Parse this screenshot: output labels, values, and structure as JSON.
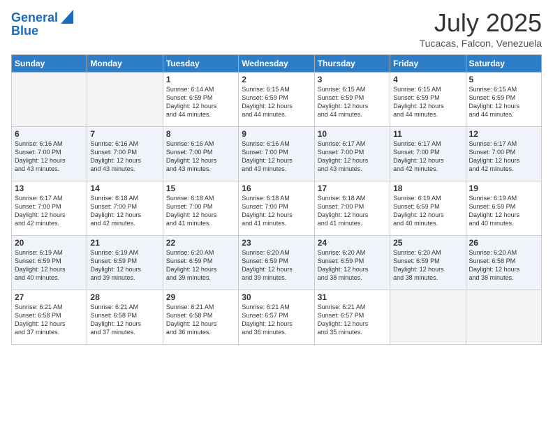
{
  "header": {
    "logo_line1": "General",
    "logo_line2": "Blue",
    "title": "July 2025",
    "location": "Tucacas, Falcon, Venezuela"
  },
  "days_of_week": [
    "Sunday",
    "Monday",
    "Tuesday",
    "Wednesday",
    "Thursday",
    "Friday",
    "Saturday"
  ],
  "weeks": [
    [
      {
        "day": "",
        "detail": "",
        "empty": true
      },
      {
        "day": "",
        "detail": "",
        "empty": true
      },
      {
        "day": "1",
        "detail": "Sunrise: 6:14 AM\nSunset: 6:59 PM\nDaylight: 12 hours\nand 44 minutes."
      },
      {
        "day": "2",
        "detail": "Sunrise: 6:15 AM\nSunset: 6:59 PM\nDaylight: 12 hours\nand 44 minutes."
      },
      {
        "day": "3",
        "detail": "Sunrise: 6:15 AM\nSunset: 6:59 PM\nDaylight: 12 hours\nand 44 minutes."
      },
      {
        "day": "4",
        "detail": "Sunrise: 6:15 AM\nSunset: 6:59 PM\nDaylight: 12 hours\nand 44 minutes."
      },
      {
        "day": "5",
        "detail": "Sunrise: 6:15 AM\nSunset: 6:59 PM\nDaylight: 12 hours\nand 44 minutes."
      }
    ],
    [
      {
        "day": "6",
        "detail": "Sunrise: 6:16 AM\nSunset: 7:00 PM\nDaylight: 12 hours\nand 43 minutes."
      },
      {
        "day": "7",
        "detail": "Sunrise: 6:16 AM\nSunset: 7:00 PM\nDaylight: 12 hours\nand 43 minutes."
      },
      {
        "day": "8",
        "detail": "Sunrise: 6:16 AM\nSunset: 7:00 PM\nDaylight: 12 hours\nand 43 minutes."
      },
      {
        "day": "9",
        "detail": "Sunrise: 6:16 AM\nSunset: 7:00 PM\nDaylight: 12 hours\nand 43 minutes."
      },
      {
        "day": "10",
        "detail": "Sunrise: 6:17 AM\nSunset: 7:00 PM\nDaylight: 12 hours\nand 43 minutes."
      },
      {
        "day": "11",
        "detail": "Sunrise: 6:17 AM\nSunset: 7:00 PM\nDaylight: 12 hours\nand 42 minutes."
      },
      {
        "day": "12",
        "detail": "Sunrise: 6:17 AM\nSunset: 7:00 PM\nDaylight: 12 hours\nand 42 minutes."
      }
    ],
    [
      {
        "day": "13",
        "detail": "Sunrise: 6:17 AM\nSunset: 7:00 PM\nDaylight: 12 hours\nand 42 minutes."
      },
      {
        "day": "14",
        "detail": "Sunrise: 6:18 AM\nSunset: 7:00 PM\nDaylight: 12 hours\nand 42 minutes."
      },
      {
        "day": "15",
        "detail": "Sunrise: 6:18 AM\nSunset: 7:00 PM\nDaylight: 12 hours\nand 41 minutes."
      },
      {
        "day": "16",
        "detail": "Sunrise: 6:18 AM\nSunset: 7:00 PM\nDaylight: 12 hours\nand 41 minutes."
      },
      {
        "day": "17",
        "detail": "Sunrise: 6:18 AM\nSunset: 7:00 PM\nDaylight: 12 hours\nand 41 minutes."
      },
      {
        "day": "18",
        "detail": "Sunrise: 6:19 AM\nSunset: 6:59 PM\nDaylight: 12 hours\nand 40 minutes."
      },
      {
        "day": "19",
        "detail": "Sunrise: 6:19 AM\nSunset: 6:59 PM\nDaylight: 12 hours\nand 40 minutes."
      }
    ],
    [
      {
        "day": "20",
        "detail": "Sunrise: 6:19 AM\nSunset: 6:59 PM\nDaylight: 12 hours\nand 40 minutes."
      },
      {
        "day": "21",
        "detail": "Sunrise: 6:19 AM\nSunset: 6:59 PM\nDaylight: 12 hours\nand 39 minutes."
      },
      {
        "day": "22",
        "detail": "Sunrise: 6:20 AM\nSunset: 6:59 PM\nDaylight: 12 hours\nand 39 minutes."
      },
      {
        "day": "23",
        "detail": "Sunrise: 6:20 AM\nSunset: 6:59 PM\nDaylight: 12 hours\nand 39 minutes."
      },
      {
        "day": "24",
        "detail": "Sunrise: 6:20 AM\nSunset: 6:59 PM\nDaylight: 12 hours\nand 38 minutes."
      },
      {
        "day": "25",
        "detail": "Sunrise: 6:20 AM\nSunset: 6:59 PM\nDaylight: 12 hours\nand 38 minutes."
      },
      {
        "day": "26",
        "detail": "Sunrise: 6:20 AM\nSunset: 6:58 PM\nDaylight: 12 hours\nand 38 minutes."
      }
    ],
    [
      {
        "day": "27",
        "detail": "Sunrise: 6:21 AM\nSunset: 6:58 PM\nDaylight: 12 hours\nand 37 minutes."
      },
      {
        "day": "28",
        "detail": "Sunrise: 6:21 AM\nSunset: 6:58 PM\nDaylight: 12 hours\nand 37 minutes."
      },
      {
        "day": "29",
        "detail": "Sunrise: 6:21 AM\nSunset: 6:58 PM\nDaylight: 12 hours\nand 36 minutes."
      },
      {
        "day": "30",
        "detail": "Sunrise: 6:21 AM\nSunset: 6:57 PM\nDaylight: 12 hours\nand 36 minutes."
      },
      {
        "day": "31",
        "detail": "Sunrise: 6:21 AM\nSunset: 6:57 PM\nDaylight: 12 hours\nand 35 minutes."
      },
      {
        "day": "",
        "detail": "",
        "empty": true
      },
      {
        "day": "",
        "detail": "",
        "empty": true
      }
    ]
  ]
}
